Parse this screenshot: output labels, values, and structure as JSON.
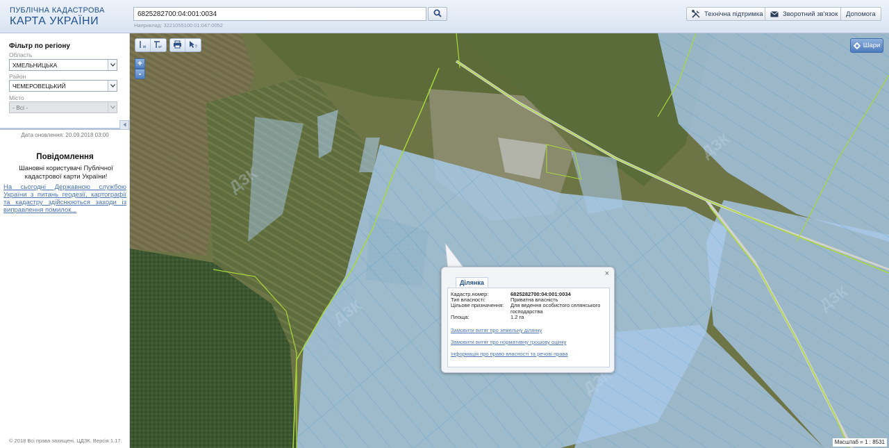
{
  "header": {
    "logo_line1": "ПУБЛІЧНА КАДАСТРОВА",
    "logo_line2": "КАРТА УКРАЇНИ",
    "search_value": "6825282700:04:001:0034",
    "search_hint": "Наприклад: 3221055100:01:047:0052",
    "search_icon": "search-icon",
    "buttons": [
      {
        "label": "Технічна підтримка",
        "icon": "tools-icon"
      },
      {
        "label": "Зворотний зв'язок",
        "icon": "envelope-icon"
      },
      {
        "label": "Допомога",
        "icon": ""
      }
    ]
  },
  "sidebar": {
    "filter_title": "Фільтр по регіону",
    "region_label": "Область",
    "region_value": "ХМЕЛЬНИЦЬКА",
    "district_label": "Район",
    "district_value": "ЧЕМЕРОВЕЦЬКИЙ",
    "city_label": "Місто",
    "city_value": "- Всі -",
    "collapse_icon": "chevron-left-icon",
    "updated": "Дата оновлення: 20.09.2018 03:00",
    "notice_title": "Повідомлення",
    "notice_text": "Шановні користувачі Публічної кадастрової карти України!",
    "notice_link": "На сьогодні Державною службою України з питань геодезії, картографії та кадастру здійснюються заходи із виправлення помилок...",
    "copyright": "© 2018 Всі права захищені. ЦДЗК. Версія 1.17."
  },
  "map": {
    "tools_group1_icons": [
      "measure-line-icon",
      "measure-area-icon"
    ],
    "tools_group2_icons": [
      "print-icon",
      "identify-icon"
    ],
    "zoom_in": "+",
    "zoom_out": "-",
    "layers_label": "Шари",
    "layers_icon": "gear-icon",
    "scale_text": "Масштаб = 1 : 8531",
    "watermark": "ДЗК"
  },
  "popup": {
    "tab_label": "Ділянка",
    "close": "×",
    "rows": [
      {
        "key": "Кадастр.номер:",
        "value": "6825282700:04:001:0034"
      },
      {
        "key": "Тип власності:",
        "value": "Приватна власність"
      },
      {
        "key": "Цільове призначення:",
        "value": "Для ведення особистого селянського господарства"
      },
      {
        "key": "Площа:",
        "value": "1.2 га"
      }
    ],
    "links": [
      "Замовити витяг про земельну ділянку",
      "Замовити витяг про нормативну грошову оцінку",
      "Інформація про право власності та речові права"
    ]
  },
  "colors": {
    "header_bg": "#dbe6f3",
    "brand_blue": "#1f4f8f",
    "parcel_fill": "#9fc3e6",
    "parcel_stroke": "#7fbfe8",
    "boundary": "#a8d93a",
    "link": "#4a74b4"
  }
}
